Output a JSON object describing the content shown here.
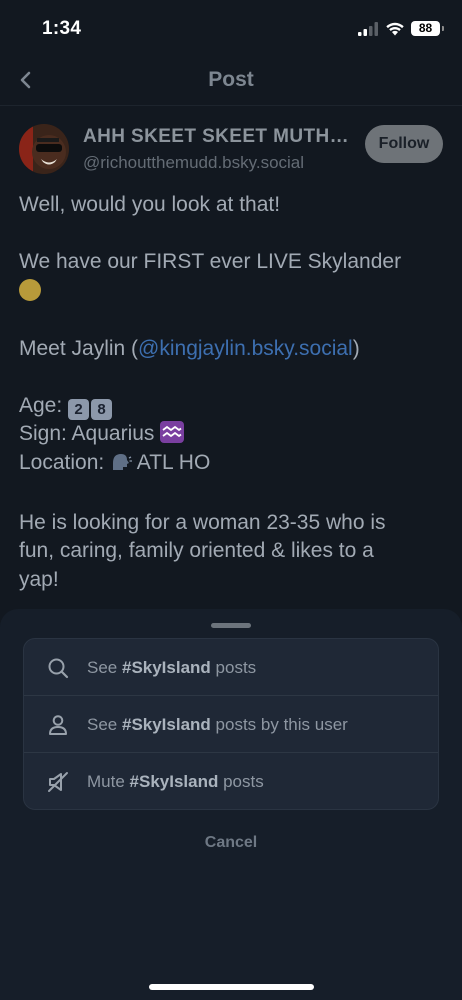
{
  "status_bar": {
    "time": "1:34",
    "battery": "88"
  },
  "header": {
    "title": "Post"
  },
  "post": {
    "author_name": "AHH SKEET SKEET MUTH…",
    "author_handle": "@richoutthemudd.bsky.social",
    "follow_label": "Follow",
    "line1": "Well, would you look at that!",
    "line2": "We have our FIRST ever LIVE Skylander",
    "line3_prefix": "Meet Jaylin (",
    "line3_mention": "@kingjaylin.bsky.social",
    "line3_suffix": ")",
    "age_label": "Age:",
    "age_digits": [
      "2",
      "8"
    ],
    "sign": "Sign: Aquarius",
    "location_label": "Location:",
    "location_value": "ATL HO",
    "closing_1": "He is looking for a woman 23-35 who is",
    "closing_2": "fun, caring, family oriented & likes to a",
    "closing_3": "yap!"
  },
  "menu": {
    "items": [
      {
        "prefix": "See ",
        "tag": "#SkyIsland",
        "suffix": " posts",
        "icon": "search-icon"
      },
      {
        "prefix": "See ",
        "tag": "#SkyIsland",
        "suffix": " posts by this user",
        "icon": "person-icon"
      },
      {
        "prefix": "Mute ",
        "tag": "#SkyIsland",
        "suffix": " posts",
        "icon": "mute-icon"
      }
    ],
    "cancel_label": "Cancel"
  },
  "colors": {
    "background": "#121820",
    "sheet": "#161e29",
    "mention": "#3d6fb0",
    "follow_button": "#6e7378"
  }
}
